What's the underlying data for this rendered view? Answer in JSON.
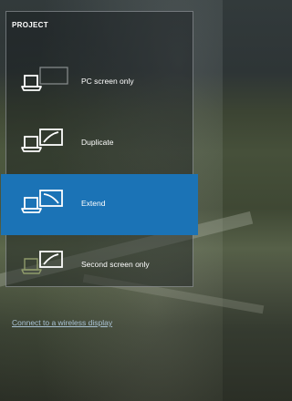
{
  "panel": {
    "title": "PROJECT",
    "options": [
      {
        "label": "PC screen only",
        "icon": "pc-screen-only-icon",
        "selected": false
      },
      {
        "label": "Duplicate",
        "icon": "duplicate-icon",
        "selected": false
      },
      {
        "label": "Extend",
        "icon": "extend-icon",
        "selected": true
      },
      {
        "label": "Second screen only",
        "icon": "second-screen-only-icon",
        "selected": false
      }
    ]
  },
  "wireless_link": "Connect to a wireless display",
  "colors": {
    "selected": "#1b73b6",
    "link": "#a9c2d4",
    "dim_icon": "#8e9a6a"
  }
}
